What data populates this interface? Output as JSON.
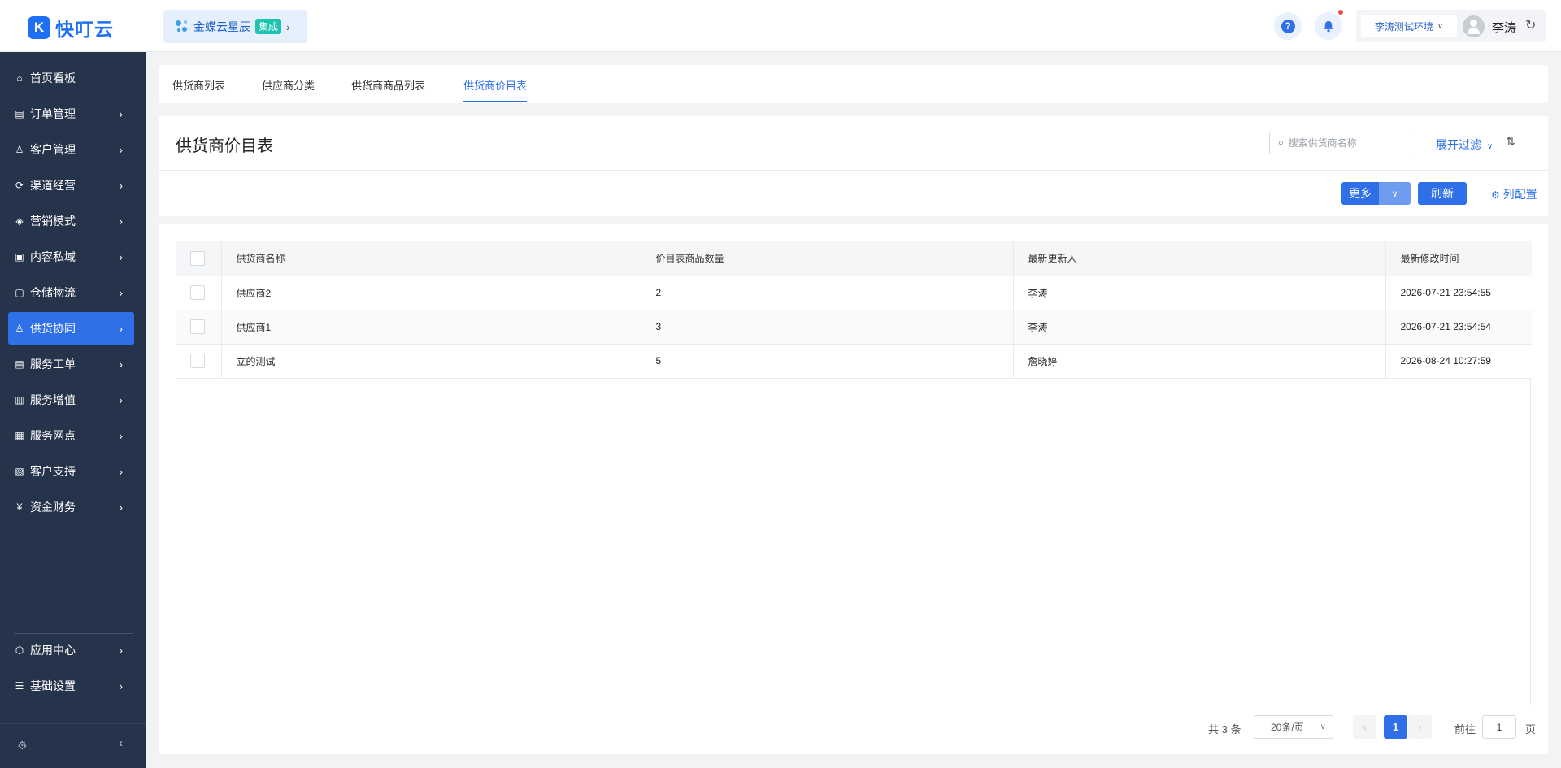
{
  "app": {
    "logo_text": "快叮云",
    "logo_glyph": "K"
  },
  "integration": {
    "name": "金蝶云星辰",
    "tag": "集成"
  },
  "header": {
    "help_glyph": "?",
    "environment": "李涛测试环境",
    "user_name": "李涛"
  },
  "sidebar": {
    "items": [
      {
        "label": "首页看板",
        "icon": "home-icon",
        "glyph": "⌂",
        "has_arrow": false
      },
      {
        "label": "订单管理",
        "icon": "clipboard-icon",
        "glyph": "▤",
        "has_arrow": true
      },
      {
        "label": "客户管理",
        "icon": "user-icon",
        "glyph": "♙",
        "has_arrow": true
      },
      {
        "label": "渠道经营",
        "icon": "channel-icon",
        "glyph": "⟳",
        "has_arrow": true
      },
      {
        "label": "营销模式",
        "icon": "tag-icon",
        "glyph": "◈",
        "has_arrow": true
      },
      {
        "label": "内容私域",
        "icon": "image-icon",
        "glyph": "▣",
        "has_arrow": true
      },
      {
        "label": "仓储物流",
        "icon": "warehouse-icon",
        "glyph": "▢",
        "has_arrow": true
      },
      {
        "label": "供货协同",
        "icon": "supplier-icon",
        "glyph": "♙",
        "has_arrow": true,
        "active": true
      },
      {
        "label": "服务工单",
        "icon": "workorder-icon",
        "glyph": "▤",
        "has_arrow": true
      },
      {
        "label": "服务增值",
        "icon": "bag-icon",
        "glyph": "▥",
        "has_arrow": true
      },
      {
        "label": "服务网点",
        "icon": "store-icon",
        "glyph": "▦",
        "has_arrow": true
      },
      {
        "label": "客户支持",
        "icon": "support-icon",
        "glyph": "▧",
        "has_arrow": true
      },
      {
        "label": "资金财务",
        "icon": "yuan-icon",
        "glyph": "¥",
        "has_arrow": true
      }
    ],
    "bottom_items": [
      {
        "label": "应用中心",
        "icon": "cube-icon",
        "glyph": "⬡",
        "has_arrow": true
      },
      {
        "label": "基础设置",
        "icon": "settings-list-icon",
        "glyph": "☰",
        "has_arrow": true
      }
    ]
  },
  "tabs": [
    {
      "label": "供货商列表"
    },
    {
      "label": "供应商分类"
    },
    {
      "label": "供货商商品列表"
    },
    {
      "label": "供货商价目表",
      "active": true
    }
  ],
  "page": {
    "title": "供货商价目表",
    "search_placeholder": "搜索供货商名称",
    "filter_label": "展开过滤",
    "more_label": "更多",
    "refresh_label": "刷新",
    "column_config_label": "列配置"
  },
  "table": {
    "columns": [
      "供货商名称",
      "价目表商品数量",
      "最新更新人",
      "最新修改时间"
    ],
    "rows": [
      [
        "供应商2",
        "2",
        "李涛",
        "2026-07-21 23:54:55"
      ],
      [
        "供应商1",
        "3",
        "李涛",
        "2026-07-21 23:54:54"
      ],
      [
        "立的测试",
        "5",
        "詹晓婷",
        "2026-08-24 10:27:59"
      ]
    ]
  },
  "pagination": {
    "total": "共 3 条",
    "page_size": "20条/页",
    "current_page": "1",
    "goto_label": "前往",
    "goto_value": "1",
    "goto_unit": "页"
  },
  "colors": {
    "accent": "#2f6fe8",
    "sidebar_bg": "#25334b",
    "tag_bg": "#1cc3b0"
  }
}
